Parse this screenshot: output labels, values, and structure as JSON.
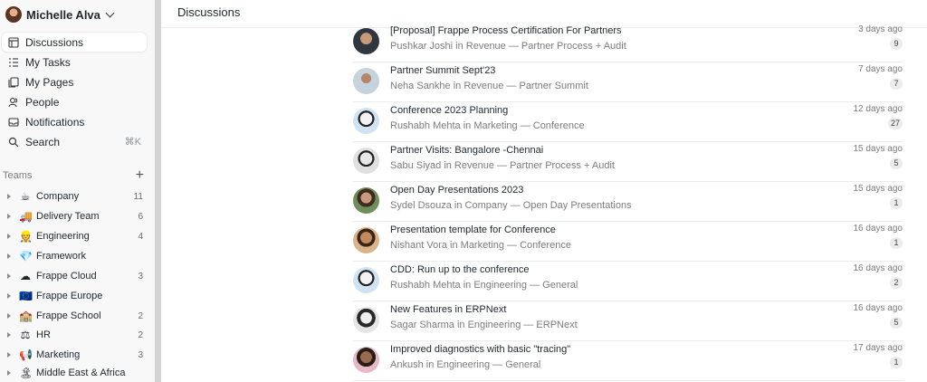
{
  "user": {
    "name": "Michelle Alva"
  },
  "nav": [
    {
      "label": "Discussions",
      "icon": "discussions-icon",
      "active": true
    },
    {
      "label": "My Tasks",
      "icon": "tasks-icon"
    },
    {
      "label": "My Pages",
      "icon": "pages-icon"
    },
    {
      "label": "People",
      "icon": "people-icon"
    },
    {
      "label": "Notifications",
      "icon": "inbox-icon"
    },
    {
      "label": "Search",
      "icon": "search-icon",
      "shortcut": "⌘K"
    }
  ],
  "teams_header": {
    "label": "Teams",
    "add_icon": "plus-icon"
  },
  "teams": [
    {
      "emoji": "☕",
      "label": "Company",
      "count": "11"
    },
    {
      "emoji": "🚚",
      "label": "Delivery Team",
      "count": "6"
    },
    {
      "emoji": "👷",
      "label": "Engineering",
      "count": "4"
    },
    {
      "emoji": "💎",
      "label": "Framework",
      "count": ""
    },
    {
      "emoji": "☁",
      "label": "Frappe Cloud",
      "count": "3"
    },
    {
      "emoji": "🇪🇺",
      "label": "Frappe Europe",
      "count": ""
    },
    {
      "emoji": "🏫",
      "label": "Frappe School",
      "count": "2"
    },
    {
      "emoji": "⚖",
      "label": "HR",
      "count": "2"
    },
    {
      "emoji": "📢",
      "label": "Marketing",
      "count": "3"
    },
    {
      "emoji": "🏝",
      "label": "Middle East & Africa",
      "count": ""
    }
  ],
  "page": {
    "title": "Discussions"
  },
  "discussions": [
    {
      "title": "[Proposal] Frappe Process Certification For Partners",
      "meta": "Pushkar Joshi in Revenue — Partner Process + Audit",
      "time": "3 days ago",
      "count": "9"
    },
    {
      "title": "Partner Summit Sept'23",
      "meta": "Neha Sankhe in Revenue — Partner Summit",
      "time": "7 days ago",
      "count": "7"
    },
    {
      "title": "Conference 2023 Planning",
      "meta": "Rushabh Mehta in Marketing — Conference",
      "time": "12 days ago",
      "count": "27"
    },
    {
      "title": "Partner Visits: Bangalore -Chennai",
      "meta": "Sabu Siyad in Revenue — Partner Process + Audit",
      "time": "15 days ago",
      "count": "5"
    },
    {
      "title": "Open Day Presentations 2023",
      "meta": "Sydel Dsouza in Company — Open Day Presentations",
      "time": "15 days ago",
      "count": "1"
    },
    {
      "title": "Presentation template for Conference",
      "meta": "Nishant Vora in Marketing — Conference",
      "time": "16 days ago",
      "count": "1"
    },
    {
      "title": "CDD: Run up to the conference",
      "meta": "Rushabh Mehta in Engineering — General",
      "time": "16 days ago",
      "count": "2"
    },
    {
      "title": "New Features in ERPNext",
      "meta": "Sagar Sharma in Engineering — ERPNext",
      "time": "16 days ago",
      "count": "5"
    },
    {
      "title": "Improved diagnostics with basic \"tracing\"",
      "meta": "Ankush in Engineering — General",
      "time": "17 days ago",
      "count": "1"
    }
  ]
}
